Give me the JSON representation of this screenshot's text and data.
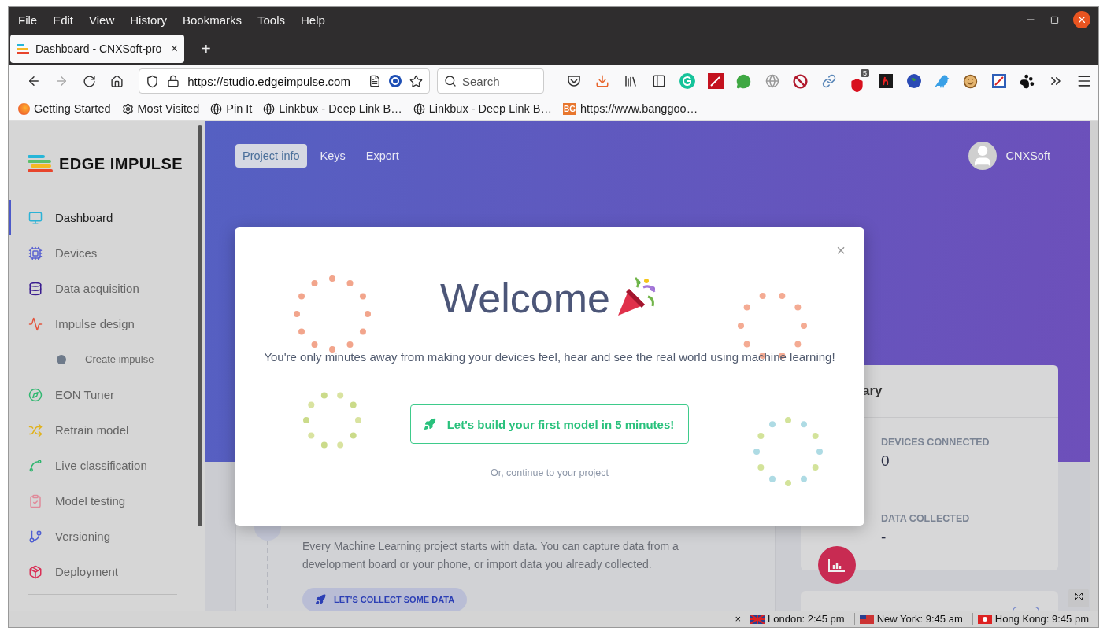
{
  "browser": {
    "menu": [
      "File",
      "Edit",
      "View",
      "History",
      "Bookmarks",
      "Tools",
      "Help"
    ],
    "tabs": [
      {
        "title": "Dashboard - CNXSoft-pro",
        "close": "×",
        "selected": true
      }
    ],
    "new_tab": "+",
    "url": "https://studio.edgeimpulse.com",
    "search": {
      "placeholder": "Search"
    },
    "extension_badge": "5",
    "bookmarks": [
      {
        "label": "Getting Started",
        "kind": "fox"
      },
      {
        "label": "Most Visited",
        "kind": "gear"
      },
      {
        "label": "Pin It",
        "kind": "globe"
      },
      {
        "label": "Linkbux - Deep Link B…",
        "kind": "globe"
      },
      {
        "label": "Linkbux - Deep Link B…",
        "kind": "globe"
      },
      {
        "label": "https://www.banggoo…",
        "kind": "favicon",
        "favicon": "BG"
      }
    ]
  },
  "app": {
    "logo": "EDGE IMPULSE",
    "sidebar": [
      {
        "label": "Dashboard",
        "selected": true
      },
      {
        "label": "Devices",
        "selected": false
      },
      {
        "label": "Data acquisition",
        "selected": false
      },
      {
        "label": "Impulse design",
        "selected": false,
        "children": [
          {
            "label": "Create impulse",
            "selected": false
          }
        ]
      },
      {
        "label": "EON Tuner",
        "selected": false
      },
      {
        "label": "Retrain model",
        "selected": false
      },
      {
        "label": "Live classification",
        "selected": false
      },
      {
        "label": "Model testing",
        "selected": false
      },
      {
        "label": "Versioning",
        "selected": false
      },
      {
        "label": "Deployment",
        "selected": false
      }
    ],
    "header_tabs": [
      {
        "label": "Project info",
        "selected": true
      },
      {
        "label": "Keys",
        "selected": false
      },
      {
        "label": "Export",
        "selected": false
      }
    ],
    "user": "CNXSoft",
    "getting_started": {
      "text": "Every Machine Learning project starts with data. You can capture data from a development board or your phone, or import data you already collected.",
      "button": "LET'S COLLECT SOME DATA"
    },
    "summary": {
      "title": "ary",
      "stats": [
        {
          "label": "DEVICES CONNECTED",
          "value": "0"
        },
        {
          "label": "DATA COLLECTED",
          "value": "-"
        }
      ]
    }
  },
  "modal": {
    "close": "×",
    "title": "Welcome",
    "message": "You're only minutes away from making your devices feel, hear and see the real world using machine learning!",
    "primary_button": "Let's build your first model in 5 minutes!",
    "link": "Or, continue to your project"
  },
  "status_bar": {
    "close": "×",
    "clocks": [
      {
        "text": "London: 2:45 pm",
        "kind": "uk"
      },
      {
        "text": "New York: 9:45 am",
        "kind": "us"
      },
      {
        "text": "Hong Kong: 9:45 pm",
        "kind": "hk"
      }
    ]
  }
}
